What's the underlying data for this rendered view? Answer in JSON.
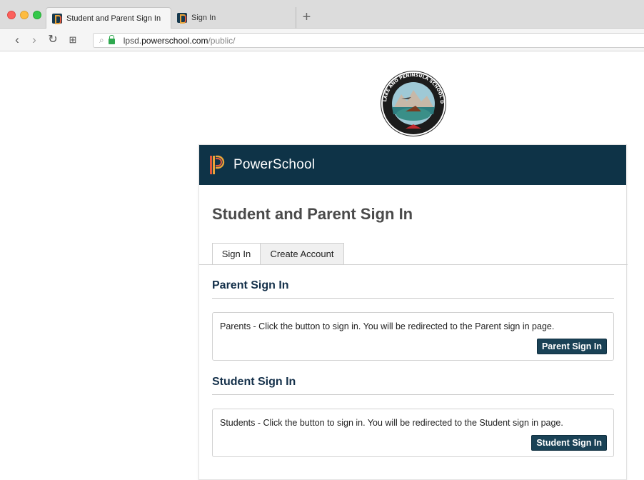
{
  "browser": {
    "tabs": [
      {
        "label": "Student and Parent Sign In",
        "active": true
      },
      {
        "label": "Sign In",
        "active": false
      }
    ],
    "new_tab_label": "+",
    "url": {
      "domain_prefix": "lpsd.",
      "domain": "powerschool.com",
      "path": "/public/"
    }
  },
  "header": {
    "brand": "PowerSchool"
  },
  "page": {
    "title": "Student and Parent Sign In",
    "tabs": [
      {
        "label": "Sign In",
        "selected": true
      },
      {
        "label": "Create Account",
        "selected": false
      }
    ],
    "parent": {
      "title": "Parent Sign In",
      "message": "Parents - Click the button to sign in. You will be redirected to the Parent sign in page.",
      "button": "Parent Sign In"
    },
    "student": {
      "title": "Student Sign In",
      "message": "Students - Click the button to sign in. You will be redirected to the Student sign in page.",
      "button": "Student Sign In"
    }
  },
  "logo": {
    "text": "LAKE AND PENINSULA SCHOOL DISTRICT"
  },
  "colors": {
    "header_bg": "#0e3347",
    "button_bg": "#1a4256",
    "section_title": "#14304a"
  }
}
